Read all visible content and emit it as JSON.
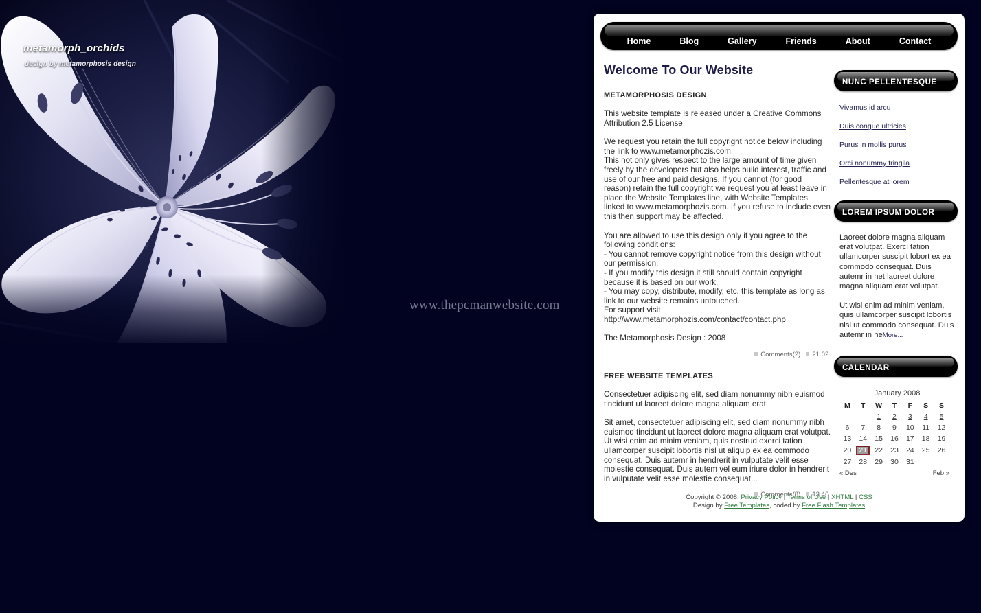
{
  "site": {
    "background_color": "#010320",
    "logo_title": "metamorph_orchids",
    "logo_subtitle": "design by metamorphosis design",
    "watermark": "www.thepcmanwebsite.com"
  },
  "nav": {
    "items": [
      {
        "label": "Home"
      },
      {
        "label": "Blog"
      },
      {
        "label": "Gallery"
      },
      {
        "label": "Friends"
      },
      {
        "label": "About"
      },
      {
        "label": "Contact"
      }
    ]
  },
  "main": {
    "heading": "Welcome To Our Website",
    "posts": [
      {
        "title": "METAMORPHOSIS DESIGN",
        "paragraphs": [
          "This website template is released under a Creative Commons Attribution 2.5 License",
          "We request you retain the full copyright notice below including the link to www.metamorphozis.com.\nThis not only gives respect to the large amount of time given freely by the developers but also helps build interest, traffic and use of our free and paid designs. If you cannot (for good reason) retain the full copyright we request you at least leave in place the Website Templates line, with Website Templates linked to www.metamorphozis.com. If you refuse to include even this then support may be affected.",
          "You are allowed to use this design only if you agree to the following conditions:\n- You cannot remove copyright notice from this design without our permission.\n- If you modify this design it still should contain copyright because it is based on our work.\n- You may copy, distribute, modify, etc. this template as long as link to our website remains untouched.\nFor support visit http://www.metamorphozis.com/contact/contact.php",
          "The Metamorphosis Design : 2008"
        ],
        "comments": "Comments(2)",
        "time": "21.02."
      },
      {
        "title": "FREE WEBSITE TEMPLATES",
        "paragraphs": [
          "Consectetuer adipiscing elit, sed diam nonummy nibh euismod tincidunt ut laoreet dolore magna aliquam erat.",
          "Sit amet, consectetuer adipiscing elit, sed diam nonummy nibh euismod tincidunt ut laoreet dolore magna aliquam erat volutpat. Ut wisi enim ad minim veniam, quis nostrud exerci tation ullamcorper suscipit lobortis nisl ut aliquip ex ea commodo consequat. Duis autemr in hendrerit in vulputate velit esse molestie consequat. Duis autem vel eum iriure dolor in hendrerit in vulputate velit esse molestie consequat..."
        ],
        "comments": "Comments(8)",
        "time": "13.46."
      }
    ]
  },
  "sidebar": {
    "block1": {
      "title": "NUNC PELLENTESQUE",
      "links": [
        "Vivamus id arcu",
        "Duis congue ultricies",
        "Purus in mollis purus",
        "Orci nonummy fringila",
        "Pellentesque at lorem"
      ]
    },
    "block2": {
      "title": "LOREM IPSUM DOLOR",
      "paragraph1": "Laoreet dolore magna aliquam erat volutpat. Exerci tation ullamcorper suscipit lobort ex ea commodo consequat. Duis autemr in het laoreet dolore magna aliquam erat volutpat.",
      "paragraph2": "Ut wisi enim ad minim veniam, quis ullamcorper suscipit lobortis nisl ut commodo consequat. Duis autemr in he",
      "more_label": "More..."
    },
    "calendar": {
      "title": "CALENDAR",
      "caption": "January 2008",
      "weekdays": [
        "M",
        "T",
        "W",
        "T",
        "F",
        "S",
        "S"
      ],
      "weeks": [
        [
          "",
          "",
          "1",
          "2",
          "3",
          "4",
          "5"
        ],
        [
          "6",
          "7",
          "8",
          "9",
          "10",
          "11",
          "12"
        ],
        [
          "13",
          "14",
          "15",
          "16",
          "17",
          "18",
          "19"
        ],
        [
          "20",
          "21",
          "22",
          "23",
          "24",
          "25",
          "26"
        ],
        [
          "27",
          "28",
          "29",
          "30",
          "31",
          "",
          ""
        ]
      ],
      "linked_days": [
        "1",
        "2",
        "3",
        "4",
        "5"
      ],
      "today": "21",
      "prev_label": "« Des",
      "next_label": "Feb »"
    }
  },
  "footer": {
    "line1_prefix": "Copyright © 2008. ",
    "privacy": "Privacy Policy",
    "sep1": " | ",
    "terms": "Terms of Use",
    "sep2": " | ",
    "xhtml": "XHTML",
    "sep3": " | ",
    "css": "CSS",
    "line2_prefix": "Design by ",
    "free_templates": "Free Templates",
    "line2_mid": ", coded by ",
    "free_flash": "Free Flash Templates"
  }
}
